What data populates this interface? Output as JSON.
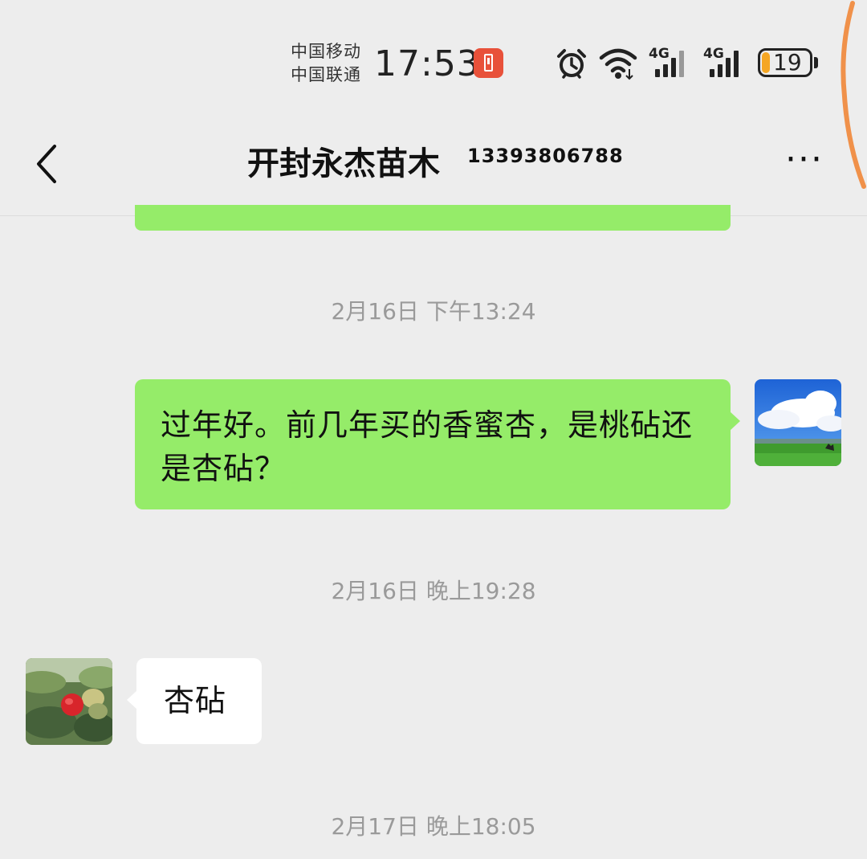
{
  "status_bar": {
    "carrier_1": "中国移动",
    "carrier_2": "中国联通",
    "time": "17:53",
    "network_1": "4G",
    "network_2": "4G",
    "battery_level": "19",
    "battery_color": "#f5a623",
    "icons": [
      "power-save-icon",
      "alarm-icon",
      "wifi-icon",
      "signal-icon",
      "signal-icon",
      "battery-icon"
    ]
  },
  "nav": {
    "title": "开封永杰苗木",
    "title_phone": "13393806788",
    "back_icon": "chevron-left-icon",
    "more_label": "···"
  },
  "messages": {
    "timestamps": [
      "2月16日 下午13:24",
      "2月16日 晚上19:28",
      "2月17日 晚上18:05"
    ],
    "outgoing_text": "过年好。前几年买的香蜜杏，是桃砧还是杏砧？",
    "incoming_text": "杏砧",
    "outgoing_color": "#95ec69",
    "incoming_color": "#ffffff"
  }
}
